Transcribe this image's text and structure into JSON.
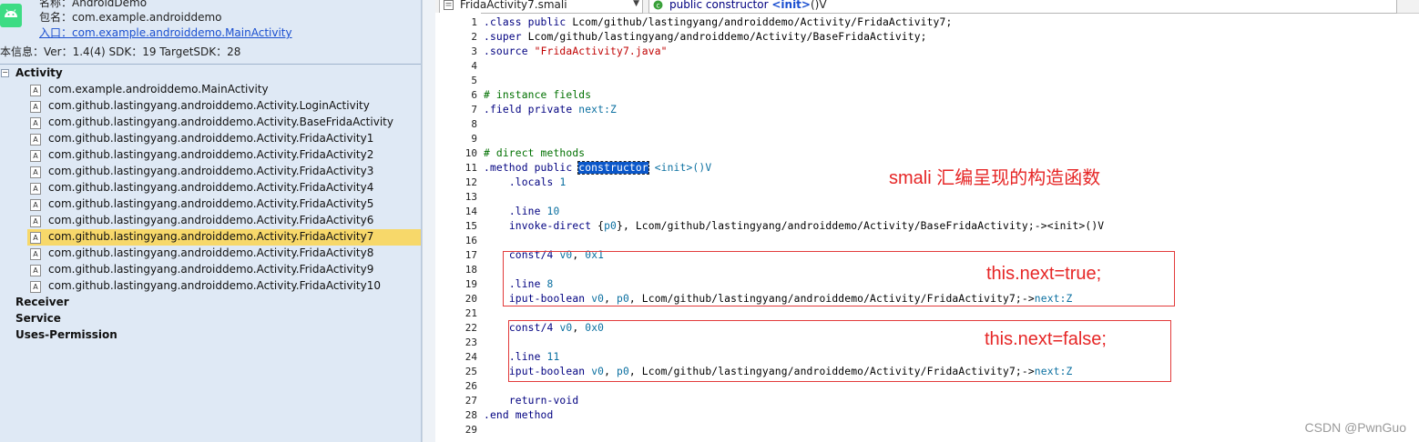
{
  "app_info": {
    "name_line": "名称：AndroidDemo",
    "package_line": "包名：com.example.androiddemo",
    "entry_line": "入口：com.example.androiddemo.MainActivity",
    "version_line": "本信息：Ver：1.4(4) SDK：19 TargetSDK：28"
  },
  "tree": {
    "toggle": "−",
    "activity_label": "Activity",
    "activities": [
      "com.example.androiddemo.MainActivity",
      "com.github.lastingyang.androiddemo.Activity.LoginActivity",
      "com.github.lastingyang.androiddemo.Activity.BaseFridaActivity",
      "com.github.lastingyang.androiddemo.Activity.FridaActivity1",
      "com.github.lastingyang.androiddemo.Activity.FridaActivity2",
      "com.github.lastingyang.androiddemo.Activity.FridaActivity3",
      "com.github.lastingyang.androiddemo.Activity.FridaActivity4",
      "com.github.lastingyang.androiddemo.Activity.FridaActivity5",
      "com.github.lastingyang.androiddemo.Activity.FridaActivity6",
      "com.github.lastingyang.androiddemo.Activity.FridaActivity7",
      "com.github.lastingyang.androiddemo.Activity.FridaActivity8",
      "com.github.lastingyang.androiddemo.Activity.FridaActivity9",
      "com.github.lastingyang.androiddemo.Activity.FridaActivity10"
    ],
    "selected_activity": "com.github.lastingyang.androiddemo.Activity.FridaActivity7",
    "receiver_label": "Receiver",
    "service_label": "Service",
    "permission_label": "Uses-Permission",
    "file_icon_glyph": "A"
  },
  "editor": {
    "file_name": "FridaActivity7.smali",
    "method_kw": "public constructor ",
    "method_init": "<init>",
    "method_sig": "()V",
    "lines": [
      {
        "n": "1",
        "parts": [
          {
            "t": ".class public",
            "c": "kw"
          },
          {
            "t": " Lcom/github/lastingyang/androiddemo/Activity/FridaActivity7;"
          }
        ]
      },
      {
        "n": "2",
        "parts": [
          {
            "t": ".super",
            "c": "kw"
          },
          {
            "t": " Lcom/github/lastingyang/androiddemo/Activity/BaseFridaActivity;"
          }
        ]
      },
      {
        "n": "3",
        "parts": [
          {
            "t": ".source",
            "c": "kw"
          },
          {
            "t": " "
          },
          {
            "t": "\"FridaActivity7.java\"",
            "c": "str"
          }
        ]
      },
      {
        "n": "4",
        "parts": []
      },
      {
        "n": "5",
        "parts": []
      },
      {
        "n": "6",
        "parts": [
          {
            "t": "# instance fields",
            "c": "cm"
          }
        ]
      },
      {
        "n": "7",
        "parts": [
          {
            "t": ".field private",
            "c": "kw"
          },
          {
            "t": " "
          },
          {
            "t": "next:Z",
            "c": "fld"
          }
        ]
      },
      {
        "n": "8",
        "parts": []
      },
      {
        "n": "9",
        "parts": []
      },
      {
        "n": "10",
        "parts": [
          {
            "t": "# direct methods",
            "c": "cm"
          }
        ]
      },
      {
        "n": "11",
        "parts": [
          {
            "t": ".method public",
            "c": "kw"
          },
          {
            "t": " "
          },
          {
            "t": "constructor",
            "c": "hl"
          },
          {
            "t": " "
          },
          {
            "t": "<init>",
            "c": "reg"
          },
          {
            "t": "()V",
            "c": "reg"
          }
        ]
      },
      {
        "n": "12",
        "parts": [
          {
            "t": "    "
          },
          {
            "t": ".locals",
            "c": "kw"
          },
          {
            "t": " "
          },
          {
            "t": "1",
            "c": "num"
          }
        ]
      },
      {
        "n": "13",
        "parts": []
      },
      {
        "n": "14",
        "parts": [
          {
            "t": "    "
          },
          {
            "t": ".line",
            "c": "kw"
          },
          {
            "t": " "
          },
          {
            "t": "10",
            "c": "num"
          }
        ]
      },
      {
        "n": "15",
        "parts": [
          {
            "t": "    "
          },
          {
            "t": "invoke-direct",
            "c": "kw"
          },
          {
            "t": " {"
          },
          {
            "t": "p0",
            "c": "reg"
          },
          {
            "t": "}, Lcom/github/lastingyang/androiddemo/Activity/BaseFridaActivity;-><init>()V"
          }
        ]
      },
      {
        "n": "16",
        "parts": []
      },
      {
        "n": "17",
        "parts": [
          {
            "t": "    "
          },
          {
            "t": "const/4",
            "c": "kw"
          },
          {
            "t": " "
          },
          {
            "t": "v0",
            "c": "reg"
          },
          {
            "t": ", "
          },
          {
            "t": "0x1",
            "c": "num"
          }
        ]
      },
      {
        "n": "18",
        "parts": []
      },
      {
        "n": "19",
        "parts": [
          {
            "t": "    "
          },
          {
            "t": ".line",
            "c": "kw"
          },
          {
            "t": " "
          },
          {
            "t": "8",
            "c": "num"
          }
        ]
      },
      {
        "n": "20",
        "parts": [
          {
            "t": "    "
          },
          {
            "t": "iput-boolean",
            "c": "kw"
          },
          {
            "t": " "
          },
          {
            "t": "v0",
            "c": "reg"
          },
          {
            "t": ", "
          },
          {
            "t": "p0",
            "c": "reg"
          },
          {
            "t": ", Lcom/github/lastingyang/androiddemo/Activity/FridaActivity7;->"
          },
          {
            "t": "next:Z",
            "c": "fld"
          }
        ]
      },
      {
        "n": "21",
        "parts": []
      },
      {
        "n": "22",
        "parts": [
          {
            "t": "    "
          },
          {
            "t": "const/4",
            "c": "kw"
          },
          {
            "t": " "
          },
          {
            "t": "v0",
            "c": "reg"
          },
          {
            "t": ", "
          },
          {
            "t": "0x0",
            "c": "num"
          }
        ]
      },
      {
        "n": "23",
        "parts": []
      },
      {
        "n": "24",
        "parts": [
          {
            "t": "    "
          },
          {
            "t": ".line",
            "c": "kw"
          },
          {
            "t": " "
          },
          {
            "t": "11",
            "c": "num"
          }
        ]
      },
      {
        "n": "25",
        "parts": [
          {
            "t": "    "
          },
          {
            "t": "iput-boolean",
            "c": "kw"
          },
          {
            "t": " "
          },
          {
            "t": "v0",
            "c": "reg"
          },
          {
            "t": ", "
          },
          {
            "t": "p0",
            "c": "reg"
          },
          {
            "t": ", Lcom/github/lastingyang/androiddemo/Activity/FridaActivity7;->"
          },
          {
            "t": "next:Z",
            "c": "fld"
          }
        ]
      },
      {
        "n": "26",
        "parts": []
      },
      {
        "n": "27",
        "parts": [
          {
            "t": "    "
          },
          {
            "t": "return-void",
            "c": "kw"
          }
        ]
      },
      {
        "n": "28",
        "parts": [
          {
            "t": ".end method",
            "c": "kw"
          }
        ]
      },
      {
        "n": "29",
        "parts": []
      }
    ]
  },
  "annotations": {
    "title": "smali 汇编呈现的构造函数",
    "box1": "this.next=true;",
    "box2": "this.next=false;"
  },
  "watermark": "CSDN @PwnGuo",
  "colors": {
    "annotation": "#e62626",
    "selection": "#f7d86a",
    "highlight": "#0b57c9"
  }
}
